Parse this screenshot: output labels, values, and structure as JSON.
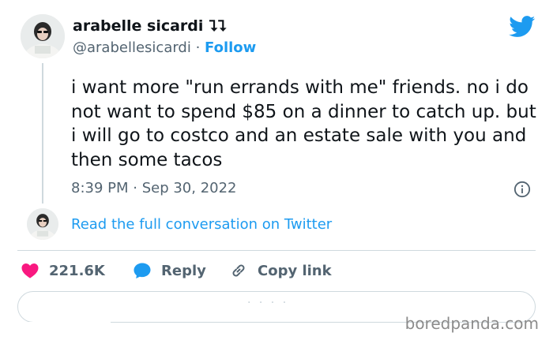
{
  "author": {
    "name": "arabelle sicardi",
    "name_suffix": "⮧⮧",
    "handle": "@arabellesicardi",
    "separator": " · ",
    "follow_label": "Follow"
  },
  "tweet": {
    "text": "i want more \"run errands with me\" friends. no i do not want to spend $85 on a dinner to catch up. but i will go to costco and an estate sale with you and then some tacos",
    "timestamp": "8:39 PM · Sep 30, 2022"
  },
  "conversation_link": "Read the full conversation on Twitter",
  "actions": {
    "like_count": "221.6K",
    "reply_label": "Reply",
    "copy_label": "Copy link"
  },
  "reply_box_faint": "· · · ·",
  "watermark": "boredpanda.com",
  "colors": {
    "twitter_blue": "#1d9bf0",
    "like_pink": "#f91880",
    "muted_text": "#536471",
    "border": "#cfd9de"
  },
  "icons": {
    "brand": "twitter-bird-icon",
    "info": "info-icon",
    "like": "heart-icon",
    "reply": "speech-bubble-icon",
    "copy": "link-icon"
  }
}
